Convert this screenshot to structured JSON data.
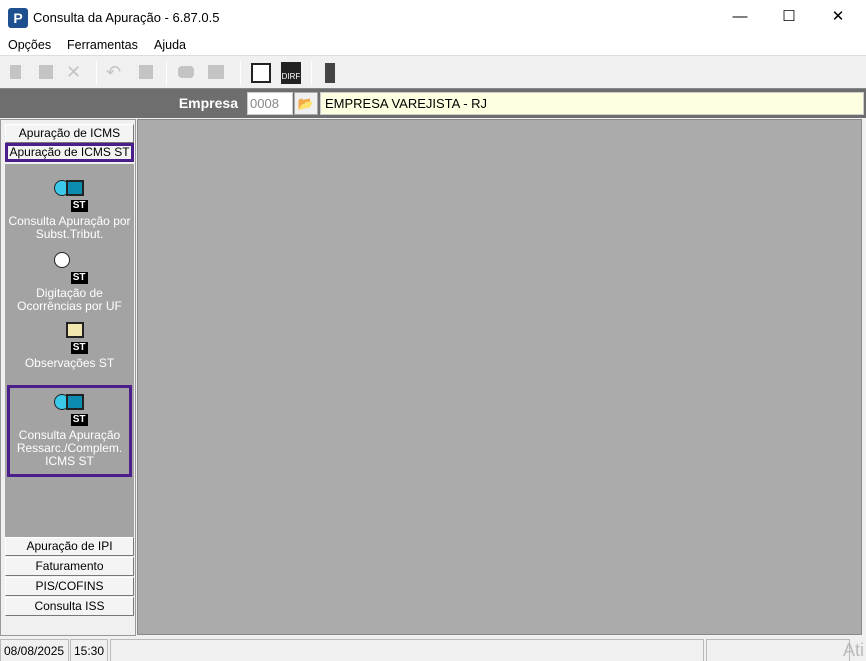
{
  "window": {
    "title": "Consulta da Apuração - 6.87.0.5",
    "icon": "P",
    "minimize": "—",
    "maximize": "☐",
    "close": "✕"
  },
  "menu": [
    "Opções",
    "Ferramentas",
    "Ajuda"
  ],
  "empresa": {
    "label": "Empresa",
    "code": "0008",
    "name": "EMPRESA VAREJISTA - RJ"
  },
  "left_tabs_top": [
    "Apuração de ICMS",
    "Apuração de ICMS ST"
  ],
  "items": [
    {
      "label": "Consulta  Apuração por Subst.Tribut.",
      "badge": "ST"
    },
    {
      "label": "Digitação de Ocorrências por UF",
      "badge": "ST"
    },
    {
      "label": "Observações ST",
      "badge": "ST"
    },
    {
      "label": "Consulta Apuração Ressarc./Complem. ICMS ST",
      "badge": "ST"
    }
  ],
  "left_tabs_bottom": [
    "Apuração de IPI",
    "Faturamento",
    "PIS/COFINS",
    "Consulta ISS"
  ],
  "status": {
    "date": "08/08/2025",
    "time": "15:30"
  },
  "watermark": "Ati",
  "colors": {
    "selection": "#4b1f8a",
    "panel": "#a3a3a3",
    "main": "#ababab"
  }
}
